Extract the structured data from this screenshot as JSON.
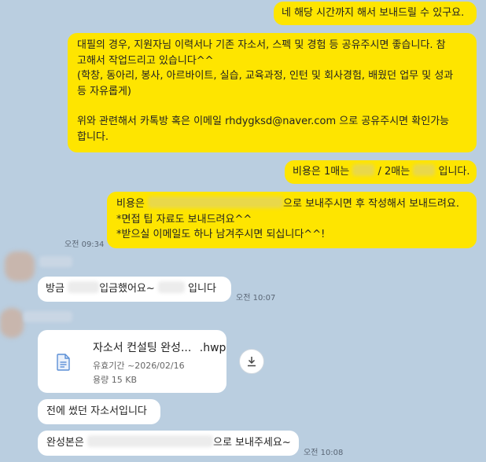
{
  "messages": {
    "m1": "네 해당 시간까지 해서 보내드릴 수 있구요.",
    "m2": {
      "line1": "대필의 경우, 지원자님 이력서나 기존 자소서, 스펙 및 경험 등 공유주시면 좋습니다. 참",
      "line2": "고해서 작업드리고 있습니다^^",
      "line3": "(학창, 동아리, 봉사, 아르바이트, 실습, 교육과정, 인턴 및 회사경험, 배웠던 업무 및 성과",
      "line4": "등 자유롭게)",
      "line5": "위와 관련해서 카톡방 혹은 이메일 rhdygksd@naver.com 으로 공유주시면 확인가능",
      "line6": "합니다."
    },
    "m3": {
      "part1": "비용은 1매는",
      "part2": "/ 2매는",
      "part3": "입니다."
    },
    "m4": {
      "prefix": "비용은",
      "suffix": "으로 보내주시면 후 작성해서 보내드려요.",
      "line2": "*면접 팁 자료도 보내드려요^^",
      "line3": "*받으실 이메일도 하나 남겨주시면 되십니다^^!"
    },
    "m4_time": "오전 09:34",
    "m5": {
      "prefix": "방금",
      "middle": "입금했어요~",
      "suffix": "입니다"
    },
    "m5_time": "오전 10:07",
    "file": {
      "name": "자소서 컨설팅 완성...",
      "ext": ".hwp",
      "expiry": "유효기간 ~2026/02/16",
      "size": "용량 15 KB",
      "file_icon": "document-icon",
      "download_icon": "download-icon"
    },
    "m6": "전에 썼던 자소서입니다",
    "m7": {
      "prefix": "완성본은",
      "suffix": "으로 보내주세요~"
    },
    "m7_time": "오전 10:08"
  },
  "colors": {
    "background": "#bacee0",
    "my_bubble": "#fee500",
    "other_bubble": "#ffffff",
    "file_icon": "#5b8fd6"
  }
}
